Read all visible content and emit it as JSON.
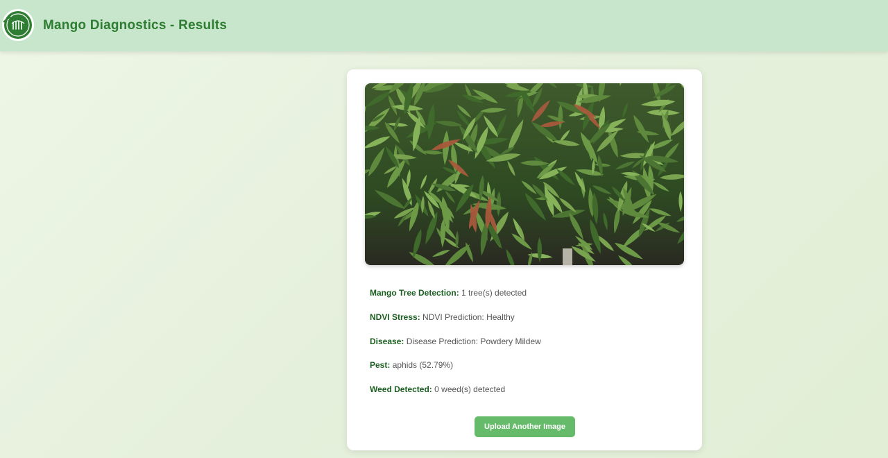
{
  "header": {
    "title": "Mango Diagnostics - Results"
  },
  "colors": {
    "header_bg": "#c8e6cc",
    "title": "#2e7d32",
    "label": "#1b5e20",
    "button": "#66bb6a"
  },
  "results": [
    {
      "label": "Mango Tree Detection:",
      "value": "1 tree(s) detected"
    },
    {
      "label": "NDVI Stress:",
      "value": "NDVI Prediction: Healthy"
    },
    {
      "label": "Disease:",
      "value": "Disease Prediction: Powdery Mildew"
    },
    {
      "label": "Pest:",
      "value": "aphids (52.79%)"
    },
    {
      "label": "Weed Detected:",
      "value": "0 weed(s) detected"
    }
  ],
  "actions": {
    "upload_label": "Upload Another Image"
  }
}
